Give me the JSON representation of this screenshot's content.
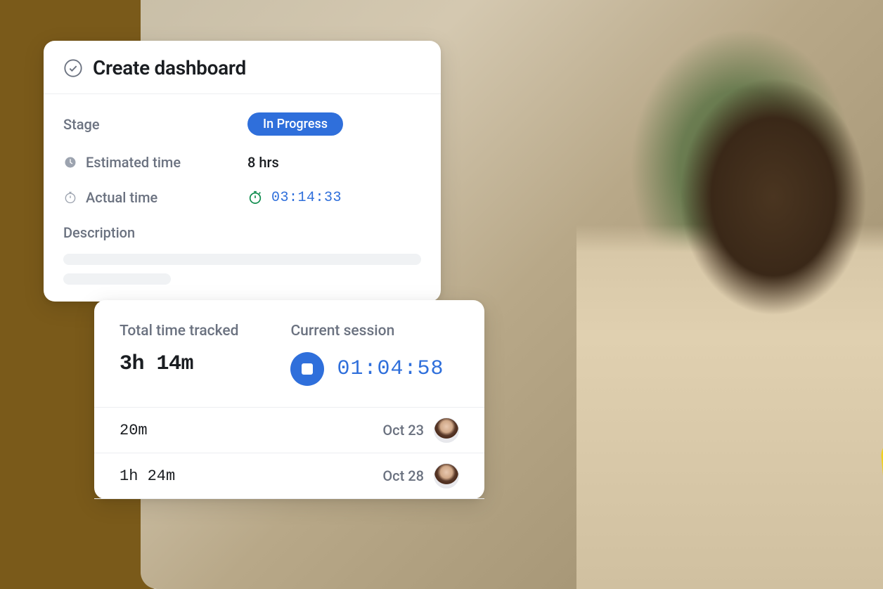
{
  "task": {
    "title": "Create dashboard",
    "stage_label": "Stage",
    "stage_value": "In Progress",
    "estimated_label": "Estimated time",
    "estimated_value": "8 hrs",
    "actual_label": "Actual time",
    "actual_value": "03:14:33",
    "description_label": "Description"
  },
  "tracking": {
    "total_label": "Total time tracked",
    "total_value": "3h 14m",
    "session_label": "Current session",
    "session_value": "01:04:58",
    "entries": [
      {
        "duration": "20m",
        "date": "Oct 23"
      },
      {
        "duration": "1h 24m",
        "date": "Oct 28"
      }
    ]
  },
  "colors": {
    "accent": "#2f6fdb",
    "timer_green": "#0a8a4a",
    "brown": "#7a5a1a"
  }
}
